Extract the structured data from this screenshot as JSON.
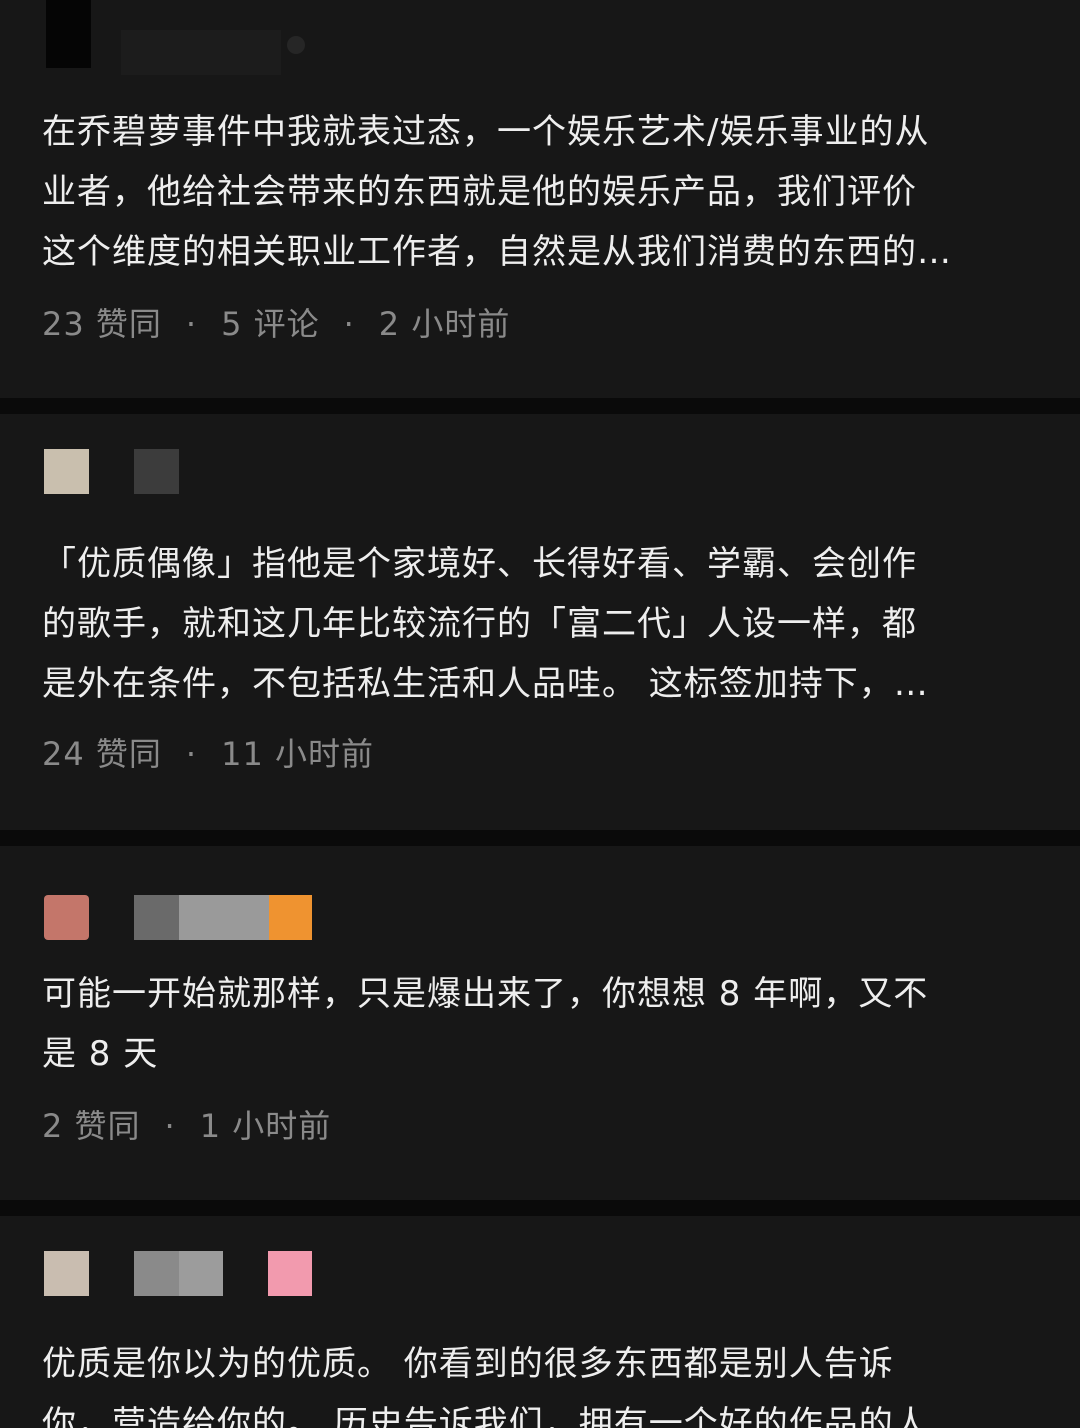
{
  "colors": {
    "background": "#0a0a0a",
    "card": "#171717",
    "text": "#eeeeee",
    "muted": "#8a8a8a"
  },
  "comments": [
    {
      "lines": [
        "在乔碧萝事件中我就表过态，一个娱乐艺术/娱乐事业的从",
        "业者，他给社会带来的东西就是他的娱乐产品，我们评价",
        "这个维度的相关职业工作者，自然是从我们消费的东西的…"
      ],
      "likes": "23 赞同",
      "replies": "5 评论",
      "time": "2 小时前"
    },
    {
      "lines": [
        "「优质偶像」指他是个家境好、长得好看、学霸、会创作",
        "的歌手，就和这几年比较流行的「富二代」人设一样，都",
        "是外在条件，不包括私生活和人品哇。 这标签加持下，…"
      ],
      "likes": "24 赞同",
      "time": "11 小时前"
    },
    {
      "lines": [
        "可能一开始就那样，只是爆出来了，你想想 8 年啊，又不",
        "是 8 天"
      ],
      "likes": "2 赞同",
      "time": "1 小时前"
    },
    {
      "lines": [
        "优质是你以为的优质。 你看到的很多东西都是别人告诉",
        "你，营造给你的。 历史告诉我们，拥有一个好的作品的人"
      ]
    }
  ],
  "separator": "·"
}
